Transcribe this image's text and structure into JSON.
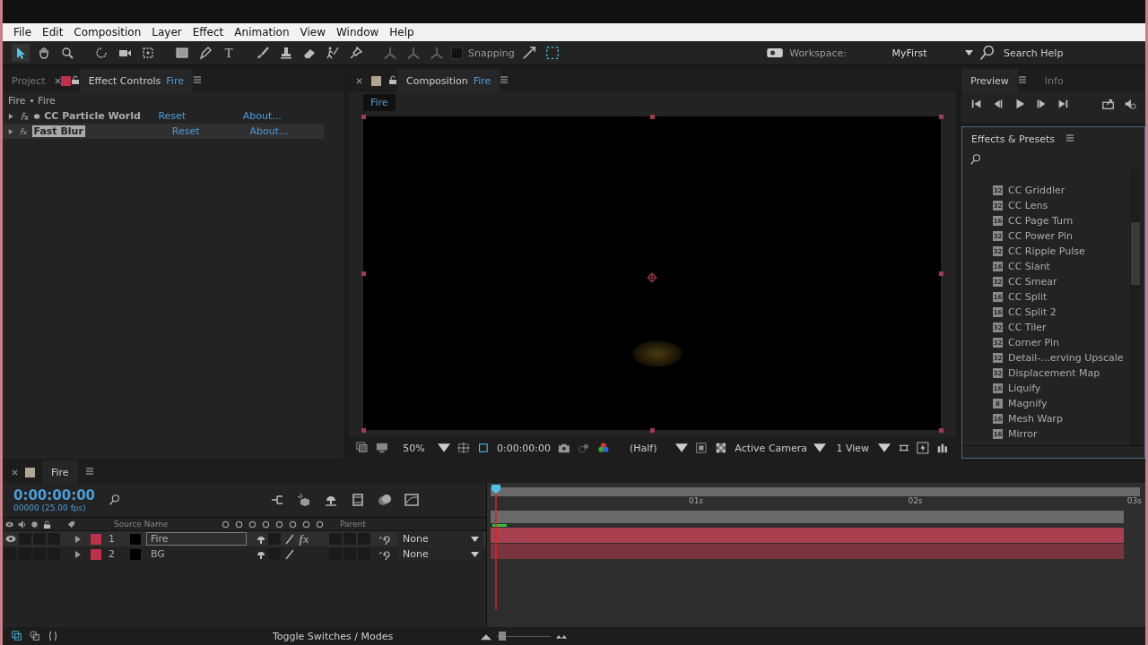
{
  "menu": [
    "File",
    "Edit",
    "Composition",
    "Layer",
    "Effect",
    "Animation",
    "View",
    "Window",
    "Help"
  ],
  "toolbar": {
    "tools": [
      {
        "kind": "select",
        "selected": true
      },
      {
        "kind": "hand",
        "selected": false
      },
      {
        "kind": "zoom",
        "selected": false
      },
      {
        "kind": "rotate",
        "selected": false
      },
      {
        "kind": "camera",
        "selected": false
      },
      {
        "kind": "pan",
        "selected": false
      },
      {
        "kind": "rect",
        "selected": false
      },
      {
        "kind": "pen",
        "selected": false
      },
      {
        "kind": "type",
        "glyph": "T",
        "selected": false
      },
      {
        "kind": "brush",
        "selected": false
      },
      {
        "kind": "stamp",
        "selected": false
      },
      {
        "kind": "eraser",
        "selected": false
      },
      {
        "kind": "roto",
        "selected": false
      },
      {
        "kind": "pin",
        "selected": false
      }
    ],
    "snapping": {
      "label": "Snapping",
      "checked": false
    },
    "workspace": {
      "label": "Workspace:",
      "value": "MyFirst"
    },
    "search": {
      "placeholder": "Search Help"
    }
  },
  "effect_controls": {
    "tabs": [
      {
        "label": "Project",
        "selected": false
      },
      {
        "label": "Effect Controls",
        "target": "Fire",
        "color": "#c0304a",
        "selected": true
      }
    ],
    "breadcrumb": "Fire • Fire",
    "effects": [
      {
        "name": "CC Particle World",
        "reset": "Reset",
        "about": "About...",
        "expanded": false,
        "selected": false,
        "kind": "cube"
      },
      {
        "name": "Fast Blur",
        "reset": "Reset",
        "about": "About...",
        "expanded": false,
        "selected": true,
        "kind": "plain"
      }
    ]
  },
  "composition": {
    "tab": {
      "label": "Composition",
      "target": "Fire",
      "color": "#b0a590"
    },
    "breadcrumb": "Fire",
    "viewer_bar": {
      "zoom": "50%",
      "timecode": "0:00:00:00",
      "resolution": "(Half)",
      "camera": "Active Camera",
      "views": "1 View"
    }
  },
  "preview": {
    "tabs": [
      {
        "label": "Preview",
        "selected": true
      },
      {
        "label": "Info",
        "selected": false
      }
    ]
  },
  "effects_presets": {
    "title": "Effects & Presets",
    "items": [
      {
        "bits": "32",
        "name": "CC Griddler"
      },
      {
        "bits": "32",
        "name": "CC Lens"
      },
      {
        "bits": "16",
        "name": "CC Page Turn"
      },
      {
        "bits": "32",
        "name": "CC Power Pin"
      },
      {
        "bits": "32",
        "name": "CC Ripple Pulse"
      },
      {
        "bits": "16",
        "name": "CC Slant"
      },
      {
        "bits": "32",
        "name": "CC Smear"
      },
      {
        "bits": "16",
        "name": "CC Split"
      },
      {
        "bits": "16",
        "name": "CC Split 2"
      },
      {
        "bits": "32",
        "name": "CC Tiler"
      },
      {
        "bits": "32",
        "name": "Corner Pin"
      },
      {
        "bits": "32",
        "name": "Detail-...erving Upscale"
      },
      {
        "bits": "32",
        "name": "Displacement Map"
      },
      {
        "bits": "16",
        "name": "Liquify"
      },
      {
        "bits": "8",
        "name": "Magnify"
      },
      {
        "bits": "16",
        "name": "Mesh Warp"
      },
      {
        "bits": "16",
        "name": "Mirror"
      }
    ]
  },
  "timeline": {
    "tab": "Fire",
    "color": "#b0a590",
    "timecode": "0:00:00:00",
    "frame_info": "00000 (25.00 fps)",
    "columns": {
      "source_name": "Source Name",
      "parent": "Parent"
    },
    "layers": [
      {
        "number": "1",
        "name": "Fire",
        "visible": true,
        "selected": true,
        "color": "#c0304a",
        "fx_switch": "fx",
        "parent": "None"
      },
      {
        "number": "2",
        "name": "BG",
        "visible": false,
        "selected": false,
        "color": "#c0304a",
        "parent": "None"
      }
    ],
    "zoom": {
      "level": 0.1
    },
    "ruler": [
      "01s",
      "02s",
      "03s"
    ],
    "footer": "Toggle Switches / Modes"
  }
}
